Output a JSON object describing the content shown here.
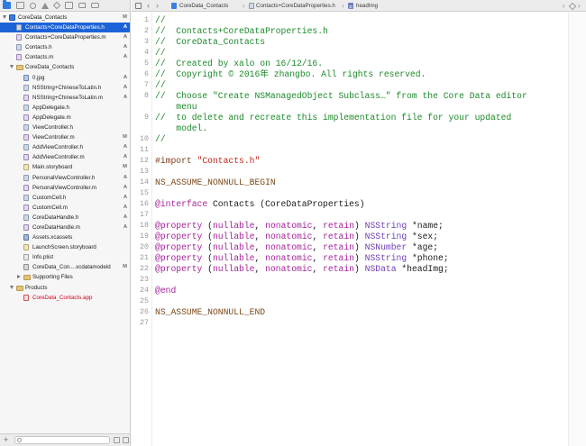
{
  "navigator": {
    "items": [
      {
        "label": "CoreData_Contacts",
        "status": "M",
        "level": 0,
        "icon": "project-icon",
        "disclosure": "open",
        "selected": false
      },
      {
        "label": "Contacts+CoreDataProperties.h",
        "status": "A",
        "level": 1,
        "icon": "header-file-icon",
        "disclosure": "",
        "selected": true
      },
      {
        "label": "Contacts+CoreDataProperties.m",
        "status": "A",
        "level": 1,
        "icon": "source-file-icon",
        "disclosure": "",
        "selected": false
      },
      {
        "label": "Contacts.h",
        "status": "A",
        "level": 1,
        "icon": "header-file-icon",
        "disclosure": "",
        "selected": false
      },
      {
        "label": "Contacts.m",
        "status": "A",
        "level": 1,
        "icon": "source-file-icon",
        "disclosure": "",
        "selected": false
      },
      {
        "label": "CoreData_Contacts",
        "status": "",
        "level": 1,
        "icon": "folder-icon",
        "disclosure": "open",
        "selected": false
      },
      {
        "label": "0.jpg",
        "status": "A",
        "level": 2,
        "icon": "image-file-icon",
        "disclosure": "",
        "selected": false
      },
      {
        "label": "NSString+ChineseToLatin.h",
        "status": "A",
        "level": 2,
        "icon": "header-file-icon",
        "disclosure": "",
        "selected": false
      },
      {
        "label": "NSString+ChineseToLatin.m",
        "status": "A",
        "level": 2,
        "icon": "source-file-icon",
        "disclosure": "",
        "selected": false
      },
      {
        "label": "AppDelegate.h",
        "status": "",
        "level": 2,
        "icon": "header-file-icon",
        "disclosure": "",
        "selected": false
      },
      {
        "label": "AppDelegate.m",
        "status": "",
        "level": 2,
        "icon": "source-file-icon",
        "disclosure": "",
        "selected": false
      },
      {
        "label": "ViewController.h",
        "status": "",
        "level": 2,
        "icon": "header-file-icon",
        "disclosure": "",
        "selected": false
      },
      {
        "label": "ViewController.m",
        "status": "M",
        "level": 2,
        "icon": "source-file-icon",
        "disclosure": "",
        "selected": false
      },
      {
        "label": "AddViewController.h",
        "status": "A",
        "level": 2,
        "icon": "header-file-icon",
        "disclosure": "",
        "selected": false
      },
      {
        "label": "AddViewController.m",
        "status": "A",
        "level": 2,
        "icon": "source-file-icon",
        "disclosure": "",
        "selected": false
      },
      {
        "label": "Main.storyboard",
        "status": "M",
        "level": 2,
        "icon": "storyboard-file-icon",
        "disclosure": "",
        "selected": false
      },
      {
        "label": "PersonalViewController.h",
        "status": "A",
        "level": 2,
        "icon": "header-file-icon",
        "disclosure": "",
        "selected": false
      },
      {
        "label": "PersonalViewController.m",
        "status": "A",
        "level": 2,
        "icon": "source-file-icon",
        "disclosure": "",
        "selected": false
      },
      {
        "label": "CustomCell.h",
        "status": "A",
        "level": 2,
        "icon": "header-file-icon",
        "disclosure": "",
        "selected": false
      },
      {
        "label": "CustomCell.m",
        "status": "A",
        "level": 2,
        "icon": "source-file-icon",
        "disclosure": "",
        "selected": false
      },
      {
        "label": "CoreDataHandle.h",
        "status": "A",
        "level": 2,
        "icon": "header-file-icon",
        "disclosure": "",
        "selected": false
      },
      {
        "label": "CoreDataHandle.m",
        "status": "A",
        "level": 2,
        "icon": "source-file-icon",
        "disclosure": "",
        "selected": false
      },
      {
        "label": "Assets.xcassets",
        "status": "",
        "level": 2,
        "icon": "assets-catalog-icon",
        "disclosure": "",
        "selected": false
      },
      {
        "label": "LaunchScreen.storyboard",
        "status": "",
        "level": 2,
        "icon": "storyboard-file-icon",
        "disclosure": "",
        "selected": false
      },
      {
        "label": "Info.plist",
        "status": "",
        "level": 2,
        "icon": "plist-file-icon",
        "disclosure": "",
        "selected": false
      },
      {
        "label": "CoreData_Con....xcdatamodeld",
        "status": "M",
        "level": 2,
        "icon": "data-model-file-icon",
        "disclosure": "",
        "selected": false
      },
      {
        "label": "Supporting Files",
        "status": "",
        "level": 2,
        "icon": "folder-icon",
        "disclosure": "closed",
        "selected": false
      },
      {
        "label": "Products",
        "status": "",
        "level": 1,
        "icon": "folder-icon",
        "disclosure": "open",
        "selected": false
      },
      {
        "label": "CoreData_Contacts.app",
        "status": "",
        "level": 2,
        "icon": "app-product-icon",
        "disclosure": "",
        "selected": false,
        "product": true
      }
    ],
    "filter_placeholder": ""
  },
  "jumpbar": {
    "crumbs": [
      "CoreData_Contacts",
      "Contacts+CoreDataProperties.h",
      "headImg"
    ],
    "method_badge": "P"
  },
  "editor": {
    "lines": [
      {
        "num": "1",
        "tokens": [
          {
            "t": "//",
            "c": "comment"
          }
        ]
      },
      {
        "num": "2",
        "tokens": [
          {
            "t": "//  Contacts+CoreDataProperties.h",
            "c": "comment"
          }
        ]
      },
      {
        "num": "3",
        "tokens": [
          {
            "t": "//  CoreData_Contacts",
            "c": "comment"
          }
        ]
      },
      {
        "num": "4",
        "tokens": [
          {
            "t": "//",
            "c": "comment"
          }
        ]
      },
      {
        "num": "5",
        "tokens": [
          {
            "t": "//  Created by xalo on 16/12/16.",
            "c": "comment"
          }
        ]
      },
      {
        "num": "6",
        "tokens": [
          {
            "t": "//  Copyright © 2016年 zhangbo. All rights reserved.",
            "c": "comment"
          }
        ]
      },
      {
        "num": "7",
        "tokens": [
          {
            "t": "//",
            "c": "comment"
          }
        ]
      },
      {
        "num": "8",
        "tokens": [
          {
            "t": "//  Choose \"Create NSManagedObject Subclass…\" from the Core Data editor",
            "c": "comment"
          }
        ]
      },
      {
        "num": "",
        "tokens": [
          {
            "t": "    menu",
            "c": "comment"
          }
        ]
      },
      {
        "num": "9",
        "tokens": [
          {
            "t": "//  to delete and recreate this implementation file for your updated",
            "c": "comment"
          }
        ]
      },
      {
        "num": "",
        "tokens": [
          {
            "t": "    model.",
            "c": "comment"
          }
        ]
      },
      {
        "num": "10",
        "tokens": [
          {
            "t": "//",
            "c": "comment"
          }
        ]
      },
      {
        "num": "11",
        "tokens": []
      },
      {
        "num": "12",
        "tokens": [
          {
            "t": "#import ",
            "c": "directive"
          },
          {
            "t": "\"Contacts.h\"",
            "c": "string"
          }
        ]
      },
      {
        "num": "13",
        "tokens": []
      },
      {
        "num": "14",
        "tokens": [
          {
            "t": "NS_ASSUME_NONNULL_BEGIN",
            "c": "macro"
          }
        ]
      },
      {
        "num": "15",
        "tokens": []
      },
      {
        "num": "16",
        "tokens": [
          {
            "t": "@interface",
            "c": "keyword"
          },
          {
            "t": " Contacts (CoreDataProperties)",
            "c": "plain"
          }
        ]
      },
      {
        "num": "17",
        "tokens": []
      },
      {
        "num": "18",
        "tokens": [
          {
            "t": "@property",
            "c": "keyword"
          },
          {
            "t": " (",
            "c": "plain"
          },
          {
            "t": "nullable",
            "c": "keyword"
          },
          {
            "t": ", ",
            "c": "plain"
          },
          {
            "t": "nonatomic",
            "c": "keyword"
          },
          {
            "t": ", ",
            "c": "plain"
          },
          {
            "t": "retain",
            "c": "keyword"
          },
          {
            "t": ") ",
            "c": "plain"
          },
          {
            "t": "NSString",
            "c": "class"
          },
          {
            "t": " *name;",
            "c": "plain"
          }
        ]
      },
      {
        "num": "19",
        "tokens": [
          {
            "t": "@property",
            "c": "keyword"
          },
          {
            "t": " (",
            "c": "plain"
          },
          {
            "t": "nullable",
            "c": "keyword"
          },
          {
            "t": ", ",
            "c": "plain"
          },
          {
            "t": "nonatomic",
            "c": "keyword"
          },
          {
            "t": ", ",
            "c": "plain"
          },
          {
            "t": "retain",
            "c": "keyword"
          },
          {
            "t": ") ",
            "c": "plain"
          },
          {
            "t": "NSString",
            "c": "class"
          },
          {
            "t": " *sex;",
            "c": "plain"
          }
        ]
      },
      {
        "num": "20",
        "tokens": [
          {
            "t": "@property",
            "c": "keyword"
          },
          {
            "t": " (",
            "c": "plain"
          },
          {
            "t": "nullable",
            "c": "keyword"
          },
          {
            "t": ", ",
            "c": "plain"
          },
          {
            "t": "nonatomic",
            "c": "keyword"
          },
          {
            "t": ", ",
            "c": "plain"
          },
          {
            "t": "retain",
            "c": "keyword"
          },
          {
            "t": ") ",
            "c": "plain"
          },
          {
            "t": "NSNumber",
            "c": "class"
          },
          {
            "t": " *age;",
            "c": "plain"
          }
        ]
      },
      {
        "num": "21",
        "tokens": [
          {
            "t": "@property",
            "c": "keyword"
          },
          {
            "t": " (",
            "c": "plain"
          },
          {
            "t": "nullable",
            "c": "keyword"
          },
          {
            "t": ", ",
            "c": "plain"
          },
          {
            "t": "nonatomic",
            "c": "keyword"
          },
          {
            "t": ", ",
            "c": "plain"
          },
          {
            "t": "retain",
            "c": "keyword"
          },
          {
            "t": ") ",
            "c": "plain"
          },
          {
            "t": "NSString",
            "c": "class"
          },
          {
            "t": " *phone;",
            "c": "plain"
          }
        ]
      },
      {
        "num": "22",
        "tokens": [
          {
            "t": "@property",
            "c": "keyword"
          },
          {
            "t": " (",
            "c": "plain"
          },
          {
            "t": "nullable",
            "c": "keyword"
          },
          {
            "t": ", ",
            "c": "plain"
          },
          {
            "t": "nonatomic",
            "c": "keyword"
          },
          {
            "t": ", ",
            "c": "plain"
          },
          {
            "t": "retain",
            "c": "keyword"
          },
          {
            "t": ") ",
            "c": "plain"
          },
          {
            "t": "NSData",
            "c": "class"
          },
          {
            "t": " *headImg;",
            "c": "plain"
          }
        ]
      },
      {
        "num": "23",
        "tokens": []
      },
      {
        "num": "24",
        "tokens": [
          {
            "t": "@end",
            "c": "keyword"
          }
        ]
      },
      {
        "num": "25",
        "tokens": []
      },
      {
        "num": "26",
        "tokens": [
          {
            "t": "NS_ASSUME_NONNULL_END",
            "c": "macro"
          }
        ]
      },
      {
        "num": "27",
        "tokens": []
      }
    ]
  },
  "colors": {
    "selection": "#1d63d8",
    "comment": "#1d8a2b",
    "keyword": "#a6249c",
    "string": "#c4281c",
    "class": "#6d3fb5",
    "product": "#d0021b"
  }
}
